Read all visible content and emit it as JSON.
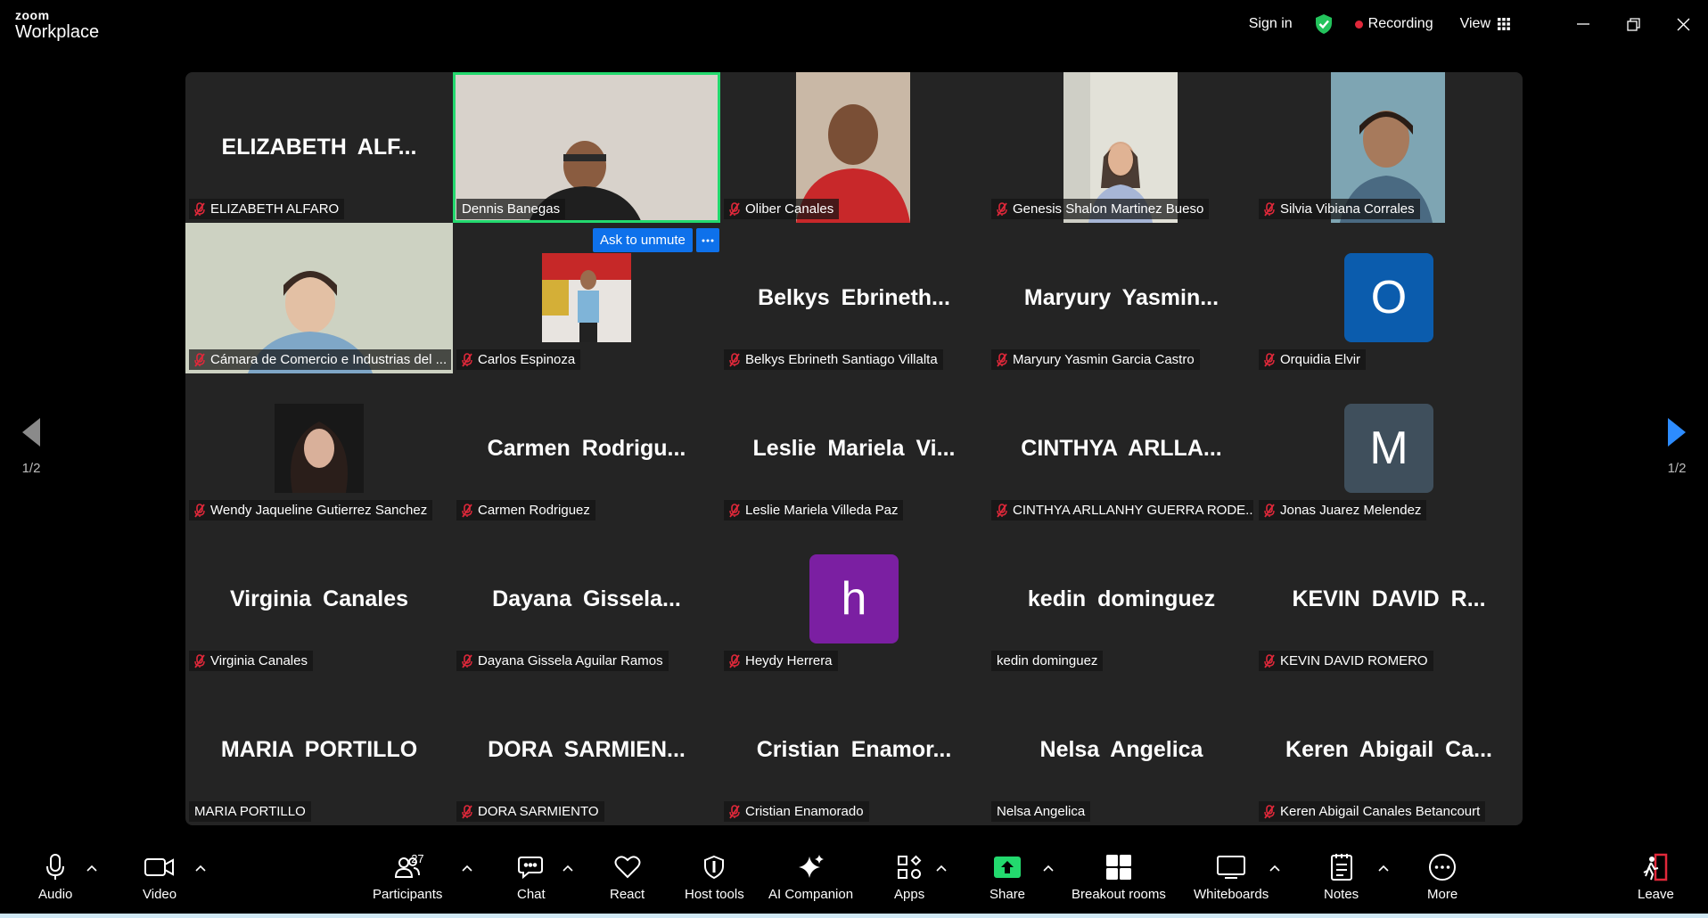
{
  "app": {
    "brand_small": "zoom",
    "brand_large": "Workplace"
  },
  "top": {
    "signin": "Sign in",
    "recording": "Recording",
    "view": "View"
  },
  "pager": {
    "left": "1/2",
    "right": "1/2"
  },
  "ask_unmute": "Ask to unmute",
  "colors": {
    "active_speaker": "#23d96e",
    "muted_mic": "#e0283a",
    "accent": "#0e71eb",
    "share": "#23d96e"
  },
  "tiles": [
    {
      "big": "ELIZABETH  ALF...",
      "label": "ELIZABETH ALFARO",
      "muted": true
    },
    {
      "big": "",
      "label": "Dennis Banegas",
      "muted": false
    },
    {
      "big": "",
      "label": "Oliber Canales",
      "muted": true
    },
    {
      "big": "",
      "label": "Genesis Shalon Martinez Bueso",
      "muted": true
    },
    {
      "big": "",
      "label": "Silvia Vibiana Corrales",
      "muted": true
    },
    {
      "big": "",
      "label": "Cámara de Comercio e Industrias del ...",
      "muted": true
    },
    {
      "big": "",
      "label": "Carlos Espinoza",
      "muted": true
    },
    {
      "big": "Belkys  Ebrineth...",
      "label": "Belkys Ebrineth Santiago Villalta",
      "muted": true
    },
    {
      "big": "Maryury  Yasmin...",
      "label": "Maryury Yasmin Garcia Castro",
      "muted": true
    },
    {
      "big": "",
      "label": "Orquidia Elvir",
      "muted": true,
      "avatar": "O",
      "avatar_color": "#0b5cad"
    },
    {
      "big": "",
      "label": "Wendy Jaqueline Gutierrez Sanchez",
      "muted": true
    },
    {
      "big": "Carmen  Rodrigu...",
      "label": "Carmen Rodriguez",
      "muted": true
    },
    {
      "big": "Leslie  Mariela  Vi...",
      "label": "Leslie Mariela Villeda Paz",
      "muted": true
    },
    {
      "big": "CINTHYA  ARLLA...",
      "label": "CINTHYA ARLLANHY GUERRA RODE...",
      "muted": true
    },
    {
      "big": "",
      "label": "Jonas Juarez Melendez",
      "muted": true,
      "avatar": "M",
      "avatar_color": "#3f4f5c"
    },
    {
      "big": "Virginia Canales",
      "label": "Virginia Canales",
      "muted": true
    },
    {
      "big": "Dayana  Gissela...",
      "label": "Dayana Gissela Aguilar Ramos",
      "muted": true
    },
    {
      "big": "",
      "label": "Heydy Herrera",
      "muted": true,
      "avatar": "h",
      "avatar_color": "#7b1fa2"
    },
    {
      "big": "kedin dominguez",
      "label": "kedin dominguez",
      "muted": false
    },
    {
      "big": "KEVIN  DAVID  R...",
      "label": "KEVIN DAVID ROMERO",
      "muted": true
    },
    {
      "big": "MARIA PORTILLO",
      "label": "MARIA PORTILLO",
      "muted": false
    },
    {
      "big": "DORA  SARMIEN...",
      "label": "DORA SARMIENTO",
      "muted": true
    },
    {
      "big": "Cristian  Enamor...",
      "label": "Cristian Enamorado",
      "muted": true
    },
    {
      "big": "Nelsa Angelica",
      "label": "Nelsa Angelica",
      "muted": false
    },
    {
      "big": "Keren  Abigail  Ca...",
      "label": "Keren Abigail Canales Betancourt",
      "muted": true
    }
  ],
  "toolbar": {
    "audio": "Audio",
    "video": "Video",
    "participants": "Participants",
    "participants_count": "27",
    "chat": "Chat",
    "react": "React",
    "host_tools": "Host tools",
    "ai_companion": "AI Companion",
    "apps": "Apps",
    "share": "Share",
    "breakout": "Breakout rooms",
    "whiteboards": "Whiteboards",
    "notes": "Notes",
    "more": "More",
    "leave": "Leave"
  }
}
